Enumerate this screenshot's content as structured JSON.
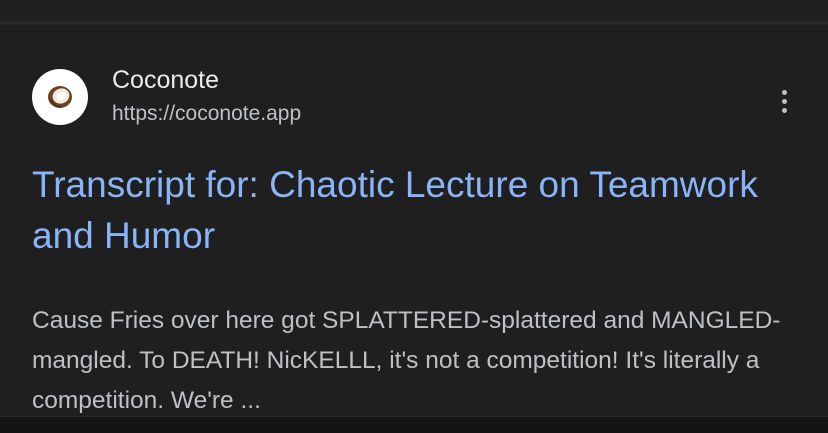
{
  "result": {
    "site_name": "Coconote",
    "site_url": "https://coconote.app",
    "favicon": "coconut-icon",
    "title": "Transcript for: Chaotic Lecture on Teamwork and Humor",
    "snippet": "Cause Fries over here got SPLATTERED-splattered and MANGLED-mangled. To DEATH! NicKELLL, it's not a competition! It's literally a competition. We're ...",
    "more_icon": "more-vert-icon"
  },
  "colors": {
    "background": "#1f1f1f",
    "title": "#8ab4f8",
    "text_primary": "#e8eaed",
    "text_secondary": "#bdc1c6"
  }
}
